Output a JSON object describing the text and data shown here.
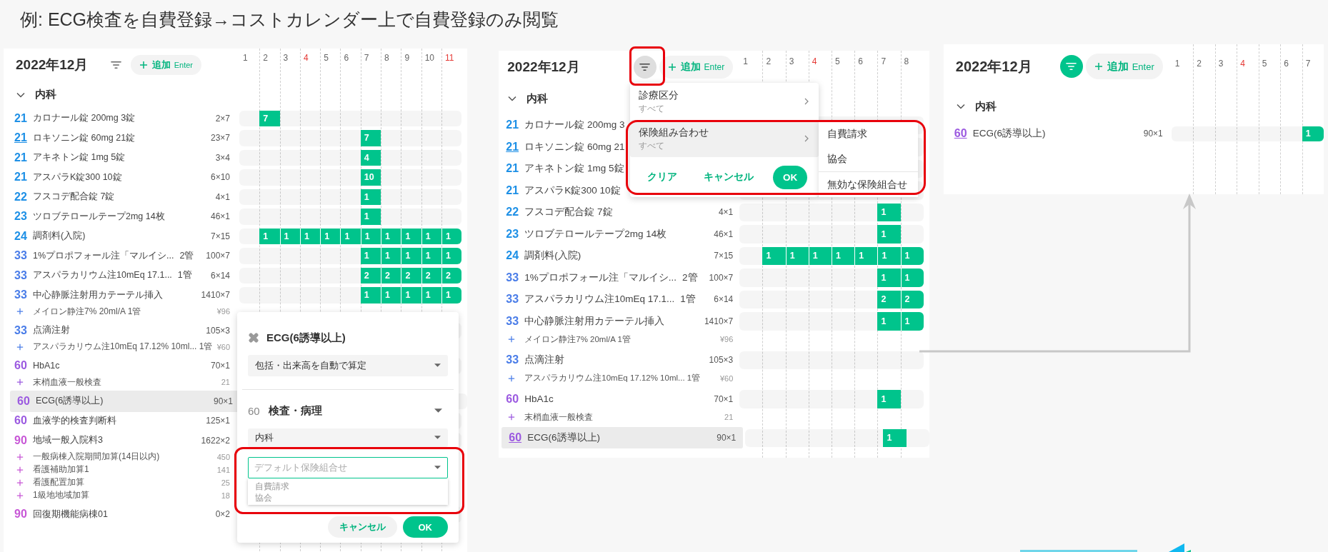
{
  "title": "例: ECG検査を自費登録→コストカレンダー上で自費登録のみ閲覧",
  "panels": [
    {
      "month": "2022年12月",
      "filter": {
        "pressed": false,
        "applied": false,
        "highlighted": false
      },
      "add": {
        "label": "追加",
        "shortcut": "Enter"
      },
      "days": [
        {
          "label": "1",
          "holiday": false
        },
        {
          "label": "2",
          "holiday": false
        },
        {
          "label": "3",
          "holiday": false
        },
        {
          "label": "4",
          "holiday": true
        },
        {
          "label": "5",
          "holiday": false
        },
        {
          "label": "6",
          "holiday": false
        },
        {
          "label": "7",
          "holiday": false
        },
        {
          "label": "8",
          "holiday": false
        },
        {
          "label": "9",
          "holiday": false
        },
        {
          "label": "10",
          "holiday": false
        },
        {
          "label": "11",
          "holiday": true
        }
      ],
      "group": {
        "label": "内科",
        "expanded": true
      },
      "rows": [
        {
          "code": "21",
          "color": "#1e90e6",
          "linked": false,
          "selected": false,
          "name": "カロナール錠 200mg 3錠",
          "qty": "2×7",
          "cells": [
            null,
            "7",
            null,
            null,
            null,
            null,
            null,
            null,
            null,
            null,
            null
          ]
        },
        {
          "code": "21",
          "color": "#1e90e6",
          "linked": true,
          "selected": false,
          "name": "ロキソニン錠 60mg 21錠",
          "qty": "23×7",
          "cells": [
            null,
            null,
            null,
            null,
            null,
            null,
            "7",
            null,
            null,
            null,
            null
          ]
        },
        {
          "code": "21",
          "color": "#1e90e6",
          "linked": false,
          "selected": false,
          "name": "アキネトン錠 1mg 5錠",
          "qty": "3×4",
          "cells": [
            null,
            null,
            null,
            null,
            null,
            null,
            "4",
            null,
            null,
            null,
            null
          ]
        },
        {
          "code": "21",
          "color": "#1e90e6",
          "linked": false,
          "selected": false,
          "name": "アスパラK錠300 10錠",
          "qty": "6×10",
          "cells": [
            null,
            null,
            null,
            null,
            null,
            null,
            "10",
            null,
            null,
            null,
            null
          ]
        },
        {
          "code": "22",
          "color": "#1e90e6",
          "linked": false,
          "selected": false,
          "name": "フスコデ配合錠 7錠",
          "qty": "4×1",
          "cells": [
            null,
            null,
            null,
            null,
            null,
            null,
            "1",
            null,
            null,
            null,
            null
          ]
        },
        {
          "code": "23",
          "color": "#1e90e6",
          "linked": false,
          "selected": false,
          "name": "ツロブテロールテープ2mg 14枚",
          "qty": "46×1",
          "cells": [
            null,
            null,
            null,
            null,
            null,
            null,
            "1",
            null,
            null,
            null,
            null
          ]
        },
        {
          "code": "24",
          "color": "#1e90e6",
          "linked": false,
          "selected": false,
          "name": "調剤料(入院)",
          "qty": "7×15",
          "cells": [
            null,
            "1",
            "1",
            "1",
            "1",
            "1",
            "1",
            "1",
            "1",
            "1",
            "1"
          ]
        },
        {
          "code": "33",
          "color": "#4a7de8",
          "linked": false,
          "selected": false,
          "name": "1%プロポフォール注「マルイシ...",
          "unit": "2管",
          "qty": "100×7",
          "cells": [
            null,
            null,
            null,
            null,
            null,
            null,
            "1",
            "1",
            "1",
            "1",
            "1"
          ]
        },
        {
          "code": "33",
          "color": "#4a7de8",
          "linked": false,
          "selected": false,
          "name": "アスパラカリウム注10mEq 17.1...",
          "unit": "1管",
          "qty": "6×14",
          "cells": [
            null,
            null,
            null,
            null,
            null,
            null,
            "2",
            "2",
            "2",
            "2",
            "2"
          ]
        },
        {
          "code": "33",
          "color": "#4a7de8",
          "linked": false,
          "selected": false,
          "name": "中心静脈注射用カテーテル挿入",
          "qty": "1410×7",
          "cells": [
            null,
            null,
            null,
            null,
            null,
            null,
            "1",
            "1",
            "1",
            "1",
            "1"
          ],
          "subitems": [
            {
              "name": "メイロン静注7% 20ml/A 1管",
              "price": "¥96"
            }
          ]
        },
        {
          "code": "33",
          "color": "#4a7de8",
          "linked": false,
          "selected": false,
          "name": "点滴注射",
          "qty": "105×3",
          "cells": [
            null,
            null,
            null,
            null,
            null,
            null,
            null,
            null,
            null,
            null,
            null
          ],
          "subitems": [
            {
              "name": "アスパラカリウム注10mEq 17.12% 10ml... 1管",
              "price": "¥60"
            }
          ]
        },
        {
          "code": "60",
          "color": "#9b59e0",
          "linked": false,
          "selected": false,
          "name": "HbA1c",
          "qty": "70×1",
          "cells": [
            null,
            null,
            null,
            null,
            null,
            null,
            null,
            null,
            null,
            null,
            null
          ],
          "subitems": [
            {
              "name": "末梢血液一般検査",
              "price": "21"
            }
          ]
        },
        {
          "code": "60",
          "color": "#9b59e0",
          "linked": false,
          "selected": true,
          "name": "ECG(6誘導以上)",
          "qty": "90×1",
          "cells": [
            null,
            null,
            null,
            null,
            null,
            null,
            null,
            null,
            null,
            null,
            null
          ]
        },
        {
          "code": "60",
          "color": "#9b59e0",
          "linked": false,
          "selected": false,
          "name": "血液学的検査判断料",
          "qty": "125×1",
          "cells": [
            null,
            null,
            null,
            null,
            null,
            null,
            null,
            null,
            null,
            null,
            null
          ]
        },
        {
          "code": "90",
          "color": "#c757d6",
          "linked": false,
          "selected": false,
          "name": "地域一般入院料3",
          "qty": "1622×2",
          "cells": [
            null,
            null,
            null,
            null,
            null,
            null,
            null,
            null,
            null,
            null,
            null
          ],
          "subitems": [
            {
              "name": "一般病棟入院期間加算(14日以内)",
              "price": "450"
            },
            {
              "name": "看護補助加算1",
              "price": "141"
            },
            {
              "name": "看護配置加算",
              "price": "25"
            },
            {
              "name": "1級地地域加算",
              "price": "18"
            }
          ]
        },
        {
          "code": "90",
          "color": "#c757d6",
          "linked": false,
          "selected": false,
          "name": "回復期機能病棟01",
          "qty": "0×2",
          "cells": [
            null,
            null,
            null,
            null,
            null,
            null,
            null,
            null,
            null,
            null,
            null
          ]
        }
      ],
      "editor": {
        "title": "ECG(6誘導以上)",
        "calculation": "包括・出来高を自動で算定",
        "category_code": "60",
        "category": "検査・病理",
        "department": "内科",
        "insurance": {
          "placeholder": "デフォルト保険組合せ",
          "focused": true,
          "highlighted": true
        },
        "options": [
          "自費請求",
          "協会"
        ],
        "buttons": [
          {
            "label": "キャンセル",
            "kind": "cancel"
          },
          {
            "label": "OK",
            "kind": "confirm"
          }
        ]
      }
    },
    {
      "month": "2022年12月",
      "filter": {
        "pressed": true,
        "applied": false,
        "highlighted": true
      },
      "add": {
        "label": "追加",
        "shortcut": "Enter"
      },
      "days": [
        {
          "label": "1",
          "holiday": false
        },
        {
          "label": "2",
          "holiday": false
        },
        {
          "label": "3",
          "holiday": false
        },
        {
          "label": "4",
          "holiday": true
        },
        {
          "label": "5",
          "holiday": false
        },
        {
          "label": "6",
          "holiday": false
        },
        {
          "label": "7",
          "holiday": false
        },
        {
          "label": "8",
          "holiday": false
        }
      ],
      "group": {
        "label": "内科",
        "expanded": true
      },
      "rows": [
        {
          "code": "21",
          "color": "#1e90e6",
          "linked": false,
          "selected": false,
          "name": "カロナール錠 200mg 3",
          "cells": [
            null,
            null,
            null,
            null,
            null,
            null,
            null,
            null
          ]
        },
        {
          "code": "21",
          "color": "#1e90e6",
          "linked": true,
          "selected": false,
          "name": "ロキソニン錠 60mg 21",
          "cells": [
            null,
            null,
            null,
            null,
            null,
            null,
            null,
            null
          ]
        },
        {
          "code": "21",
          "color": "#1e90e6",
          "linked": false,
          "selected": false,
          "name": "アキネトン錠 1mg 5錠",
          "cells": [
            null,
            null,
            null,
            null,
            null,
            null,
            null,
            null
          ]
        },
        {
          "code": "21",
          "color": "#1e90e6",
          "linked": false,
          "selected": false,
          "name": "アスパラK錠300 10錠",
          "cells": [
            null,
            null,
            null,
            null,
            null,
            null,
            null,
            null
          ]
        },
        {
          "code": "22",
          "color": "#1e90e6",
          "linked": false,
          "selected": false,
          "name": "フスコデ配合錠 7錠",
          "qty": "4×1",
          "cells": [
            null,
            null,
            null,
            null,
            null,
            null,
            "1",
            null
          ]
        },
        {
          "code": "23",
          "color": "#1e90e6",
          "linked": false,
          "selected": false,
          "name": "ツロブテロールテープ2mg 14枚",
          "qty": "46×1",
          "cells": [
            null,
            null,
            null,
            null,
            null,
            null,
            "1",
            null
          ]
        },
        {
          "code": "24",
          "color": "#1e90e6",
          "linked": false,
          "selected": false,
          "name": "調剤料(入院)",
          "qty": "7×15",
          "cells": [
            null,
            "1",
            "1",
            "1",
            "1",
            "1",
            "1",
            "1"
          ]
        },
        {
          "code": "33",
          "color": "#4a7de8",
          "linked": false,
          "selected": false,
          "name": "1%プロポフォール注「マルイシ...",
          "unit": "2管",
          "qty": "100×7",
          "cells": [
            null,
            null,
            null,
            null,
            null,
            null,
            "1",
            "1"
          ]
        },
        {
          "code": "33",
          "color": "#4a7de8",
          "linked": false,
          "selected": false,
          "name": "アスパラカリウム注10mEq 17.1...",
          "unit": "1管",
          "qty": "6×14",
          "cells": [
            null,
            null,
            null,
            null,
            null,
            null,
            "2",
            "2"
          ]
        },
        {
          "code": "33",
          "color": "#4a7de8",
          "linked": false,
          "selected": false,
          "name": "中心静脈注射用カテーテル挿入",
          "qty": "1410×7",
          "cells": [
            null,
            null,
            null,
            null,
            null,
            null,
            "1",
            "1"
          ],
          "subitems": [
            {
              "name": "メイロン静注7% 20ml/A 1管",
              "price": "¥96"
            }
          ]
        },
        {
          "code": "33",
          "color": "#4a7de8",
          "linked": false,
          "selected": false,
          "name": "点滴注射",
          "qty": "105×3",
          "cells": [
            null,
            null,
            null,
            null,
            null,
            null,
            null,
            null
          ],
          "subitems": [
            {
              "name": "アスパラカリウム注10mEq 17.12% 10ml... 1管",
              "price": "¥60"
            }
          ]
        },
        {
          "code": "60",
          "color": "#9b59e0",
          "linked": false,
          "selected": false,
          "name": "HbA1c",
          "qty": "70×1",
          "cells": [
            null,
            null,
            null,
            null,
            null,
            null,
            "1",
            null
          ],
          "subitems": [
            {
              "name": "末梢血液一般検査",
              "price": "21"
            }
          ]
        },
        {
          "code": "60",
          "color": "#9b59e0",
          "linked": true,
          "selected": true,
          "name": "ECG(6誘導以上)",
          "qty": "90×1",
          "cells": [
            null,
            null,
            null,
            null,
            null,
            null,
            "1",
            null
          ]
        }
      ],
      "filter_menu": {
        "highlighted": true,
        "items": [
          {
            "label": "診療区分",
            "value": "すべて",
            "selected": false
          },
          {
            "label": "保険組み合わせ",
            "value": "すべて",
            "selected": true
          }
        ],
        "buttons": [
          {
            "label": "クリア",
            "kind": "clear"
          },
          {
            "label": "キャンセル",
            "kind": "cancel"
          },
          {
            "label": "OK",
            "kind": "confirm"
          }
        ],
        "submenu": {
          "options": [
            "自費請求",
            "協会"
          ],
          "extra": [
            "無効な保険組合せ"
          ]
        }
      }
    },
    {
      "month": "2022年12月",
      "filter": {
        "pressed": false,
        "applied": true,
        "highlighted": false
      },
      "add": {
        "label": "追加",
        "shortcut": "Enter"
      },
      "days": [
        {
          "label": "1",
          "holiday": false
        },
        {
          "label": "2",
          "holiday": false
        },
        {
          "label": "3",
          "holiday": false
        },
        {
          "label": "4",
          "holiday": true
        },
        {
          "label": "5",
          "holiday": false
        },
        {
          "label": "6",
          "holiday": false
        },
        {
          "label": "7",
          "holiday": false
        }
      ],
      "group": {
        "label": "内科",
        "expanded": true
      },
      "rows": [
        {
          "code": "60",
          "color": "#9b59e0",
          "linked": true,
          "selected": false,
          "name": "ECG(6誘導以上)",
          "qty": "90×1",
          "cells": [
            null,
            null,
            null,
            null,
            null,
            null,
            "1"
          ]
        }
      ]
    }
  ]
}
